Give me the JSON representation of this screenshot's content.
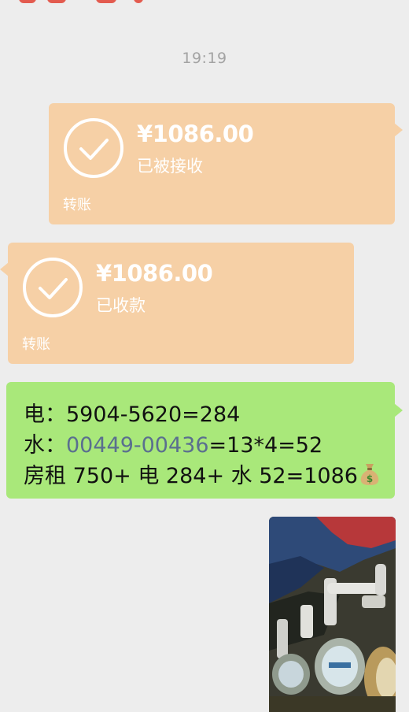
{
  "chat": {
    "timestamp": "19:19",
    "transfer_sent": {
      "amount": "¥1086.00",
      "status": "已被接收",
      "kind": "转账"
    },
    "transfer_received": {
      "amount": "¥1086.00",
      "status": "已收款",
      "kind": "转账"
    },
    "message": {
      "line1": "电：5904-5620=284",
      "line2_prefix": "水：",
      "line2_link": "00449-00436",
      "line2_suffix": "=13*4=52",
      "line3": "房租 750+ 电 284+ 水 52=1086",
      "emoji_icon": "money-bag-icon"
    },
    "image_message": {
      "description_icon": "meter-photo"
    }
  },
  "colors": {
    "background": "#ededed",
    "transfer_bubble": "#f6d0a6",
    "green_bubble": "#a9e87a",
    "link_text": "#5a6f8f",
    "timestamp": "#a3a3a3"
  }
}
